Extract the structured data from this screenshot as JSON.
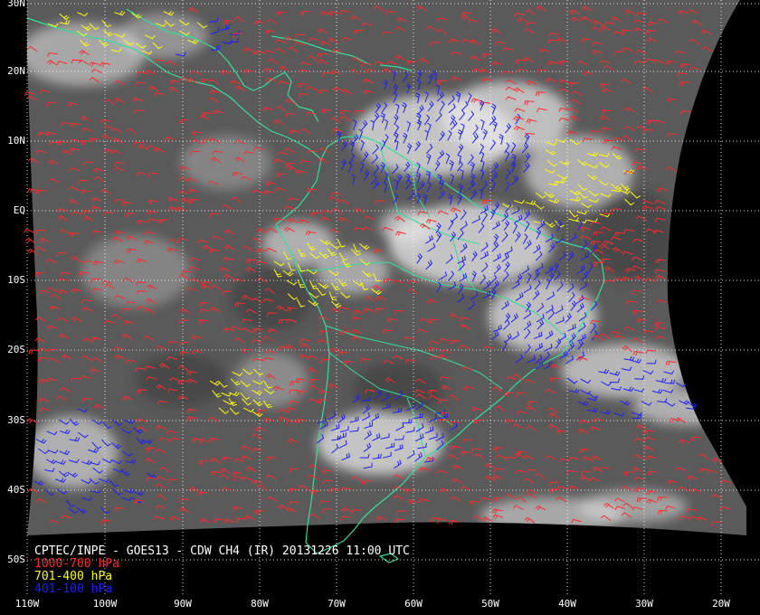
{
  "map": {
    "title": "CPTEC/INPE - GOES13 - CDW CH4 (IR) 20131226 11:00 UTC",
    "lat_labels": [
      "30N",
      "20N",
      "10N",
      "EQ",
      "10S",
      "20S",
      "30S",
      "40S",
      "50S"
    ],
    "lon_labels": [
      "110W",
      "100W",
      "90W",
      "80W",
      "70W",
      "60W",
      "50W",
      "40W",
      "30W",
      "20W"
    ],
    "legend": [
      {
        "label": "1000-700 hPa",
        "color": "#ff2a2a"
      },
      {
        "label": "701-400 hPa",
        "color": "#ffff00"
      },
      {
        "label": "401-100 hPa",
        "color": "#1e1eff"
      }
    ],
    "colors": {
      "background": "#000000",
      "coastline": "#33dd99",
      "grid": "#ffffff",
      "imagery_base": "#5a5a5a"
    }
  }
}
